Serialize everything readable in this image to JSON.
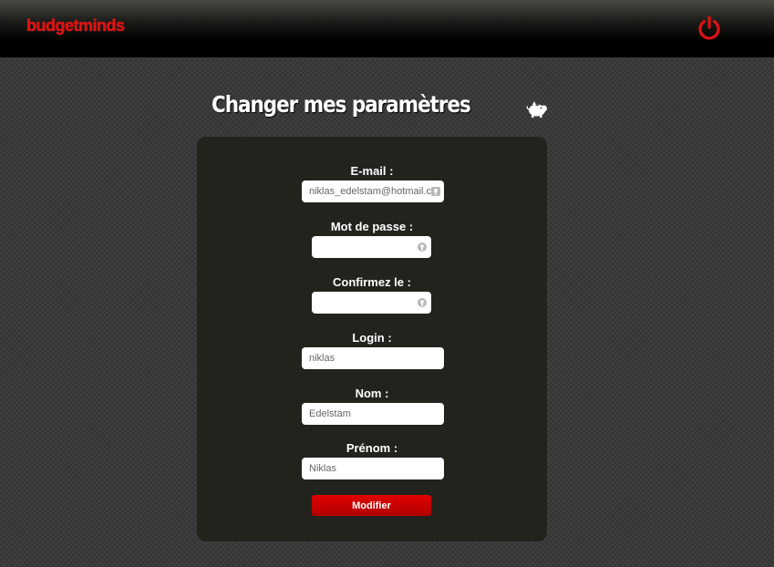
{
  "header": {
    "logo_text": "budgetminds",
    "brand_color": "#e01010",
    "power_icon": "power-icon"
  },
  "page": {
    "title": "Changer mes paramètres",
    "title_icon": "piggy-bank-icon"
  },
  "form": {
    "email": {
      "label": "E-mail :",
      "value": "niklas_edelstam@hotmail.com"
    },
    "password": {
      "label": "Mot de passe :",
      "value": ""
    },
    "confirm": {
      "label": "Confirmez le :",
      "value": ""
    },
    "login": {
      "label": "Login :",
      "value": "niklas"
    },
    "nom": {
      "label": "Nom :",
      "value": "Edelstam"
    },
    "prenom": {
      "label": "Prénom :",
      "value": "Niklas"
    },
    "submit_label": "Modifier",
    "submit_color": "#d00000"
  }
}
